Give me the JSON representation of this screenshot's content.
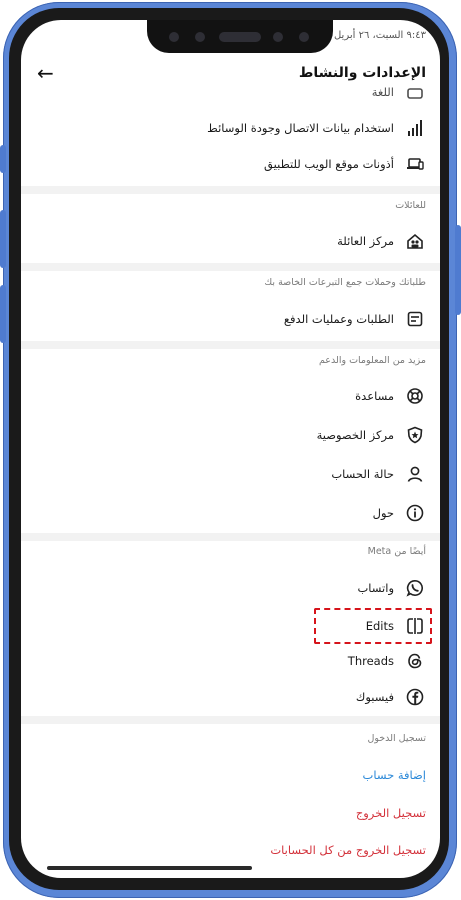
{
  "status_bar": {
    "time_date": "٩:٤٣ السبت، ٢٦ أبريل"
  },
  "header": {
    "title": "الإعدادات والنشاط"
  },
  "partial_row": {
    "label": "اللغة"
  },
  "rows_top": [
    {
      "label": "استخدام بيانات الاتصال وجودة الوسائط",
      "icon": "signal-bars-icon"
    },
    {
      "label": "أذونات موقع الويب للتطبيق",
      "icon": "devices-icon"
    }
  ],
  "family": {
    "section_title": "للعائلات",
    "items": [
      {
        "label": "مركز العائلة",
        "icon": "family-center-icon"
      }
    ]
  },
  "orders": {
    "section_title": "طلباتك وحملات جمع التبرعات الخاصة بك",
    "items": [
      {
        "label": "الطلبات وعمليات الدفع",
        "icon": "receipt-icon"
      }
    ]
  },
  "support": {
    "section_title": "مزيد من المعلومات والدعم",
    "items": [
      {
        "label": "مساعدة",
        "icon": "lifebuoy-icon"
      },
      {
        "label": "مركز الخصوصية",
        "icon": "shield-star-icon"
      },
      {
        "label": "حالة الحساب",
        "icon": "person-icon"
      },
      {
        "label": "حول",
        "icon": "info-icon"
      }
    ]
  },
  "meta": {
    "section_title": "أيضًا من Meta",
    "items": [
      {
        "label": "واتساب",
        "icon": "whatsapp-icon"
      },
      {
        "label": "Edits",
        "icon": "edits-icon"
      },
      {
        "label": "Threads",
        "icon": "threads-icon"
      },
      {
        "label": "فيسبوك",
        "icon": "facebook-icon"
      }
    ]
  },
  "login": {
    "section_title": "تسجيل الدخول",
    "add_account": "إضافة حساب",
    "logout": "تسجيل الخروج",
    "logout_all": "تسجيل الخروج من كل الحسابات"
  },
  "colors": {
    "frame": "#5b86d6",
    "link_blue": "#2a88d8",
    "link_red": "#d3323b",
    "highlight": "#d6141b"
  }
}
